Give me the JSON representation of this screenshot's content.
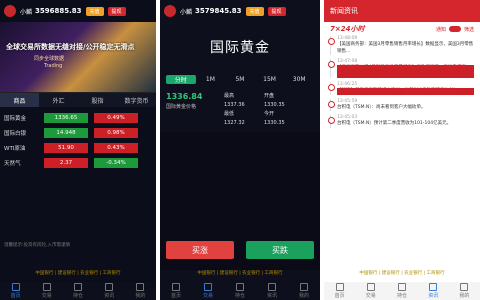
{
  "screen1": {
    "username": "小麟",
    "balance": "3596885.83",
    "btn_recharge": "充值",
    "btn_withdraw": "提现",
    "hero_title": "全球交易所数据无缝对接/公开稳定无滑点",
    "hero_sub1": "同步全球数据",
    "hero_sub2": "Trading",
    "tabs": [
      "商品",
      "外汇",
      "股指",
      "数字货币"
    ],
    "rows": [
      {
        "name": "国际黄金",
        "price": "1336.65",
        "change": "0.49%"
      },
      {
        "name": "国际白银",
        "price": "14.948",
        "change": "0.98%"
      },
      {
        "name": "WTI原油",
        "price": "51.90",
        "change": "0.43%"
      },
      {
        "name": "天然气",
        "price": "2.37",
        "change": "-0.34%"
      }
    ],
    "notice": "温馨提示:投资有风险,入市需谨慎",
    "footer": "中国银行 | 建设银行 | 农业银行 | 工商银行",
    "nav": [
      "首页",
      "交易",
      "持仓",
      "资讯",
      "我的"
    ]
  },
  "screen2": {
    "username": "小麟",
    "balance": "3579845.83",
    "btn_recharge": "充值",
    "btn_withdraw": "提现",
    "title": "国际黄金",
    "tabs": [
      "分时",
      "1M",
      "5M",
      "15M",
      "30M"
    ],
    "price": "1336.84",
    "name": "国际黄金价格",
    "high_label": "最高",
    "high": "1337.36",
    "open_label": "开盘",
    "open": "1330.35",
    "low_label": "最低",
    "low": "1327.32",
    "close_label": "今开",
    "close": "1330.35",
    "buy_up": "买涨",
    "buy_down": "买跌",
    "footer": "中国银行 | 建设银行 | 农业银行 | 工商银行",
    "nav": [
      "首页",
      "交易",
      "持仓",
      "资讯",
      "我的"
    ]
  },
  "screen3": {
    "header": "新闻资讯",
    "brand": "7×24小时",
    "toggle_label": "通知",
    "filter_label": "筛选",
    "news": [
      {
        "time": "13:48:09",
        "text": "【美国商务部：美国3月零售销售月率增长】数据显示，美国3月零售销售..."
      },
      {
        "time": "13:47:08",
        "text": "【三星宣布公司4月智能手机产量减半】据外媒报道，三星电子宣布..."
      },
      {
        "time": "13:46:25",
        "text": "【行情】美股盘指期货扩大涨幅，标普500指数期货涨0.6%。"
      },
      {
        "time": "13:45:59",
        "text": "台积电（TSM.N）：尚未看到客户大幅砍单。"
      },
      {
        "time": "13:45:03",
        "text": "台积电（TSM.N）预计第二季度营收为101-104亿美元。"
      }
    ],
    "footer": "中国银行 | 建设银行 | 农业银行 | 工商银行",
    "nav": [
      "首页",
      "交易",
      "持仓",
      "资讯",
      "我的"
    ]
  }
}
